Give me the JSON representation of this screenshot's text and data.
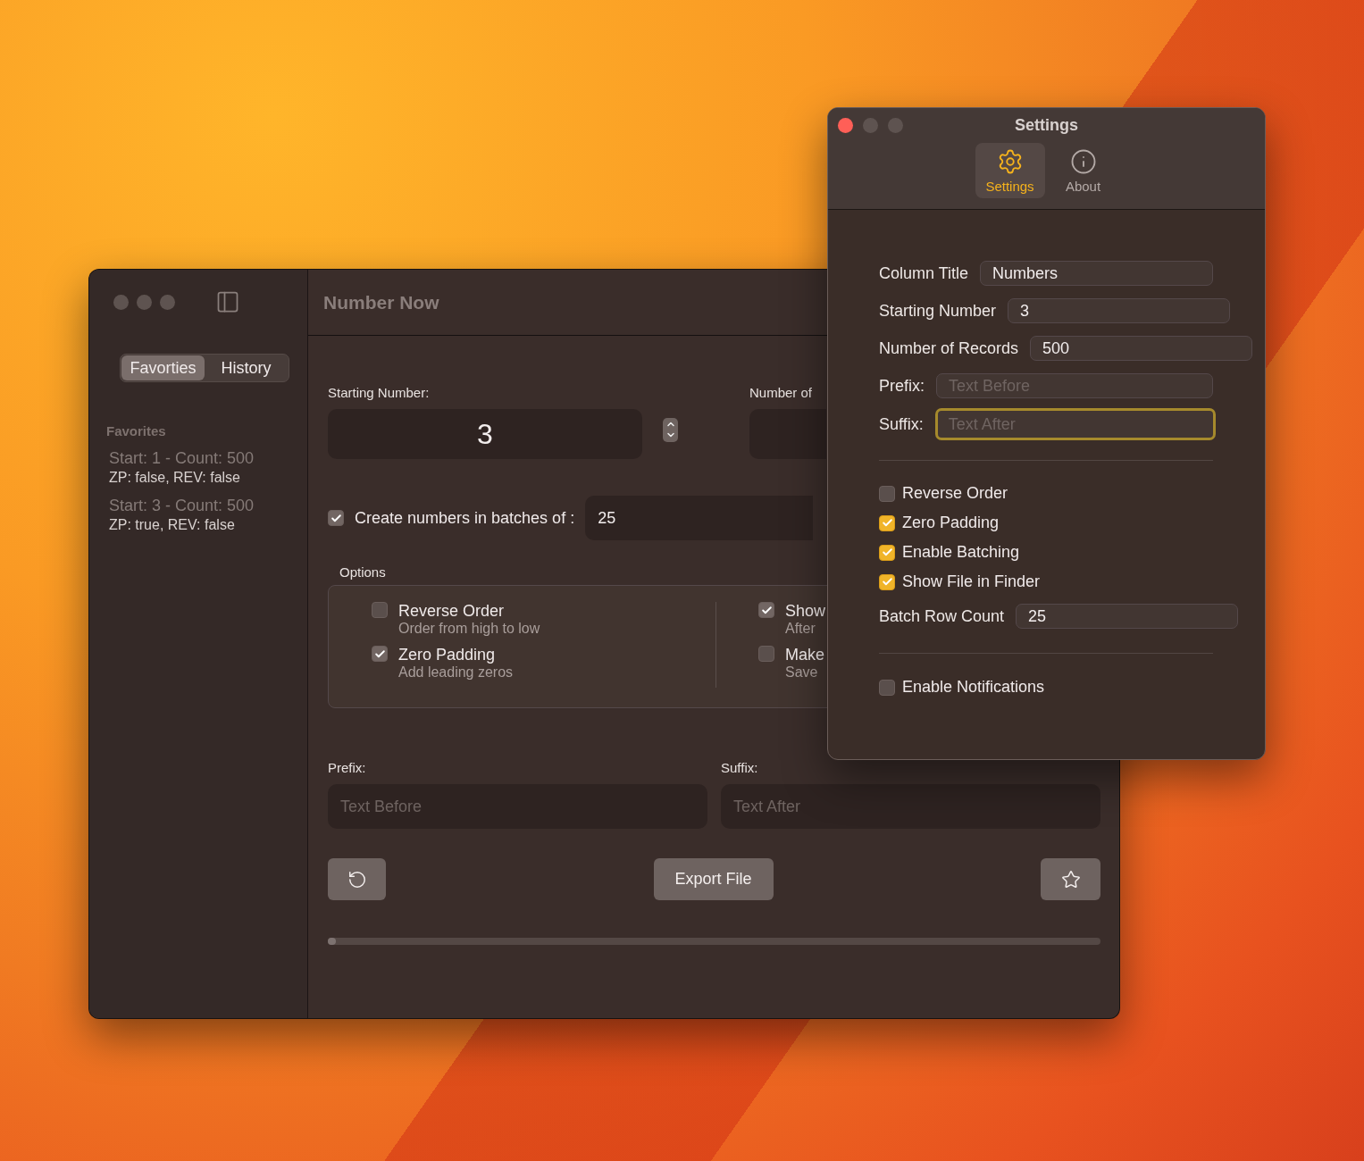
{
  "main_window": {
    "active": false,
    "title": "Number Now",
    "sidebar": {
      "segments": [
        {
          "label": "Favorties",
          "selected": true
        },
        {
          "label": "History",
          "selected": false
        }
      ],
      "section_title": "Favorites",
      "items": [
        {
          "title": "Start: 1 - Count: 500",
          "detail": "ZP: false, REV: false"
        },
        {
          "title": "Start: 3 - Count: 500",
          "detail": "ZP: true, REV: false"
        }
      ]
    },
    "starting_number": {
      "label": "Starting Number:",
      "value": "3"
    },
    "records": {
      "label": "Number of"
    },
    "batching": {
      "label": "Create numbers in batches of :",
      "checked": true,
      "value": "25"
    },
    "options": {
      "title": "Options",
      "columns": [
        [
          {
            "title": "Reverse Order",
            "subtitle": "Order from high to low",
            "checked": false
          },
          {
            "title": "Zero Padding",
            "subtitle": "Add leading zeros",
            "checked": true
          }
        ],
        [
          {
            "title": "Show",
            "subtitle": "After",
            "checked": true
          },
          {
            "title": "Make",
            "subtitle": "Save",
            "checked": false
          }
        ]
      ]
    },
    "prefix": {
      "label": "Prefix:",
      "placeholder": "Text Before"
    },
    "suffix": {
      "label": "Suffix:",
      "placeholder": "Text After"
    },
    "export_button": "Export File",
    "progress": {
      "level": 0.01
    }
  },
  "settings_window": {
    "active": true,
    "title": "Settings",
    "tabs": [
      {
        "label": "Settings",
        "selected": true,
        "kind": "gear"
      },
      {
        "label": "About",
        "selected": false,
        "kind": "info"
      }
    ],
    "fields": [
      {
        "label": "Column Title",
        "value": "Numbers",
        "focused": false
      },
      {
        "label": "Starting Number",
        "value": "3",
        "focused": false
      },
      {
        "label": "Number of Records",
        "value": "500",
        "focused": false
      },
      {
        "label": "Prefix:",
        "placeholder": "Text Before",
        "focused": false
      },
      {
        "label": "Suffix:",
        "placeholder": "Text After",
        "focused": true
      }
    ],
    "toggles": [
      {
        "label": "Reverse Order",
        "checked": false
      },
      {
        "label": "Zero Padding",
        "checked": true
      },
      {
        "label": "Enable Batching",
        "checked": true
      },
      {
        "label": "Show File in Finder",
        "checked": true
      }
    ],
    "batch_row_count": {
      "label": "Batch Row Count",
      "value": "25"
    },
    "notifications": {
      "label": "Enable Notifications",
      "checked": false
    }
  }
}
